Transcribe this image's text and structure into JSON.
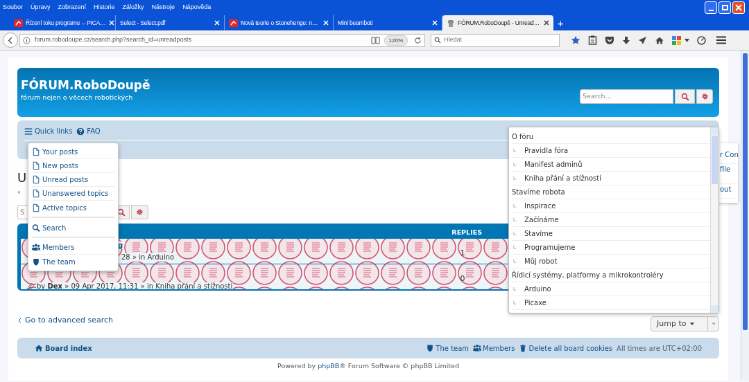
{
  "browser": {
    "menu": [
      "Soubor",
      "Úpravy",
      "Zobrazení",
      "Historie",
      "Záložky",
      "Nástroje",
      "Nápověda"
    ],
    "tabs": [
      {
        "title": "Řízení toku programu ←PICA…",
        "kind": "logo",
        "selected": false
      },
      {
        "title": "Select - Select.pdf",
        "kind": "plain",
        "selected": false
      },
      {
        "title": "Nová teorie o Stonehenge: n…",
        "kind": "logo",
        "selected": false
      },
      {
        "title": "Mini beamboti",
        "kind": "plain",
        "selected": false
      },
      {
        "title": "FÓRUM.RoboDoupě - Unread…",
        "kind": "robot",
        "selected": true
      }
    ],
    "new_tab": "+",
    "url": "forum.robodoupe.cz/search.php?search_id=unreadposts",
    "zoom": "120%",
    "search_placeholder": "Hledat"
  },
  "header": {
    "title": "FÓRUM.RoboDoupě",
    "subtitle": "fórum nejen o věcech robotických",
    "search_placeholder": "Search…"
  },
  "navbar": {
    "quick_links": "Quick links",
    "faq": "FAQ"
  },
  "quick_links": {
    "groups": [
      {
        "items": [
          {
            "label": "Your posts",
            "kind": "page"
          },
          {
            "label": "New posts",
            "kind": "page"
          },
          {
            "label": "Unread posts",
            "kind": "page"
          },
          {
            "label": "Unanswered topics",
            "kind": "page"
          },
          {
            "label": "Active topics",
            "kind": "page"
          }
        ]
      },
      {
        "items": [
          {
            "label": "Search",
            "kind": "search"
          }
        ]
      },
      {
        "items": [
          {
            "label": "Members",
            "kind": "members"
          },
          {
            "label": "The team",
            "kind": "team"
          }
        ]
      }
    ]
  },
  "user_menu_fragments": [
    "r Con",
    "file",
    "out"
  ],
  "page": {
    "title_fragment": "U",
    "back_fragment": "‹",
    "search_fragment": "S"
  },
  "table": {
    "columns": [
      {
        "label": "REPLIES"
      }
    ],
    "rows": [
      {
        "title_fragment": "g",
        "meta": "28 » in Arduino",
        "replies": "1",
        "attachment": false
      },
      {
        "meta": "by **Dex** » 09 Apr 2017, 11:31 » in Kniha přání a stížností",
        "replies": "0",
        "attachment": true
      }
    ]
  },
  "jump_list": [
    {
      "label": "O fóru",
      "children": [
        {
          "label": "Pravidla fóra"
        },
        {
          "label": "Manifest adminů"
        },
        {
          "label": "Kniha přání a stížností"
        }
      ]
    },
    {
      "label": "Stavíme robota",
      "children": [
        {
          "label": "Inspirace"
        },
        {
          "label": "Začínáme"
        },
        {
          "label": "Stavíme"
        },
        {
          "label": "Programujeme"
        },
        {
          "label": "Můj robot"
        }
      ]
    },
    {
      "label": "Řídicí systémy, platformy a mikrokontroléry",
      "children": [
        {
          "label": "Arduino"
        },
        {
          "label": "Picaxe"
        }
      ]
    }
  ],
  "advanced_search": "Go to advanced search",
  "jump_button": "Jump to",
  "footer": {
    "board_index": "Board index",
    "links": [
      {
        "label": "The team",
        "kind": "team"
      },
      {
        "label": "Members",
        "kind": "members"
      },
      {
        "label": "Delete all board cookies",
        "kind": "trash"
      }
    ],
    "timezone": "All times are UTC+02:00",
    "powered_prefix": "Powered by ",
    "powered_link": "phpBB",
    "powered_suffix": "® Forum Software © phpBB Limited"
  }
}
